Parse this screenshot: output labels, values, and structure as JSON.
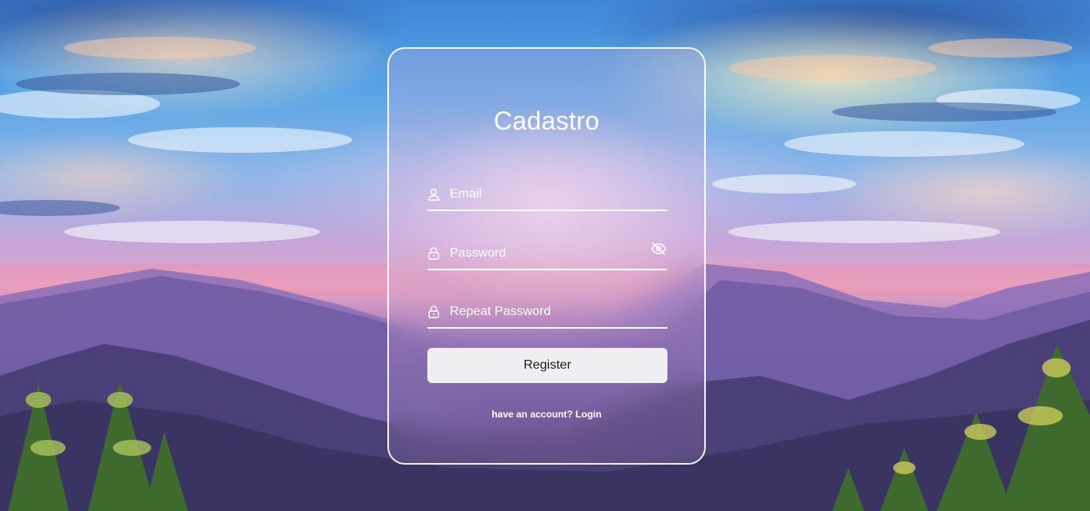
{
  "form": {
    "title": "Cadastro",
    "email_placeholder": "Email",
    "password_placeholder": "Password",
    "repeat_password_placeholder": "Repeat Password",
    "register_label": "Register",
    "login_prompt": "have an account?",
    "login_link": "Login"
  },
  "icons": {
    "email": "user-icon",
    "password": "lock-icon",
    "repeat_password": "lock-icon",
    "toggle_visibility": "eye-off-icon"
  },
  "colors": {
    "card_border": "#ffffff",
    "text": "#ffffff",
    "button_bg": "#efeff1",
    "button_text": "#1b1b1b"
  }
}
